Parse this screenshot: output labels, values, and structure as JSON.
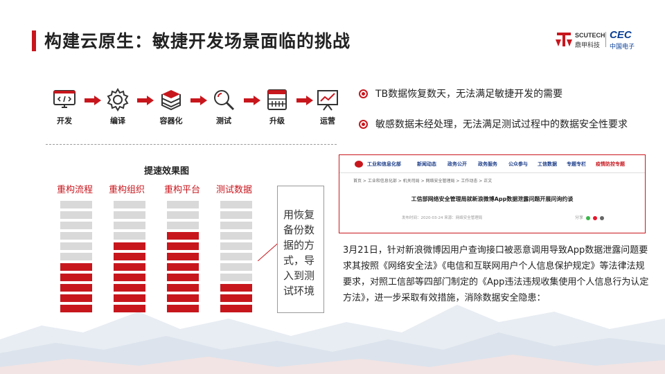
{
  "title": "构建云原生：敏捷开发场景面临的挑战",
  "logo": {
    "scutech": "SCUTECH",
    "scutech_cn": "鼎甲科技",
    "cec": "CEC",
    "cec_cn": "中国电子"
  },
  "flow": {
    "steps": [
      {
        "label": "开发",
        "icon": "code-monitor-icon"
      },
      {
        "label": "编译",
        "icon": "gear-icon"
      },
      {
        "label": "容器化",
        "icon": "container-stack-icon"
      },
      {
        "label": "测试",
        "icon": "magnifier-icon"
      },
      {
        "label": "升级",
        "icon": "server-rack-icon"
      },
      {
        "label": "运营",
        "icon": "chart-board-icon"
      }
    ]
  },
  "chart": {
    "title": "提速效果图",
    "columns": [
      {
        "label": "重构流程",
        "filled": 5
      },
      {
        "label": "重构组织",
        "filled": 7
      },
      {
        "label": "重构平台",
        "filled": 8
      },
      {
        "label": "测试数据",
        "filled": 3
      }
    ],
    "total_blocks": 11,
    "colors": {
      "filled": "#c8161d",
      "empty": "#d9d9d9"
    }
  },
  "callout": "用恢复备份数据的方式，导入到测试环境",
  "bullets": [
    "TB数据恢复数天，无法满足敏捷开发的需要",
    "敏感数据未经处理，无法满足测试过程中的数据安全性要求"
  ],
  "news_screenshot": {
    "nav": [
      "工业和信息化部",
      "新闻动态",
      "政务公开",
      "政务服务",
      "公众参与",
      "工信数据",
      "专题专栏",
      "疫情防控专题"
    ],
    "breadcrumb": "首页 > 工业和信息化部 > 机关司局 > 网络安全管理局 > 工作动态 > 正文",
    "headline": "工信部网络安全管理局就新浪微博App数据泄露问题开展问询约谈",
    "meta": "发布时间：2020-03-24   来源：网络安全管理局",
    "share": "分享"
  },
  "paragraph": "3月21日，针对新浪微博因用户查询接口被恶意调用导致App数据泄露问题要求其按照《网络安全法》《电信和互联网用户个人信息保护规定》等法律法规要求，对照工信部等四部门制定的《App违法违规收集使用个人信息行为认定方法》，进一步采取有效措施，消除数据安全隐患：",
  "accent": "#c8161d"
}
